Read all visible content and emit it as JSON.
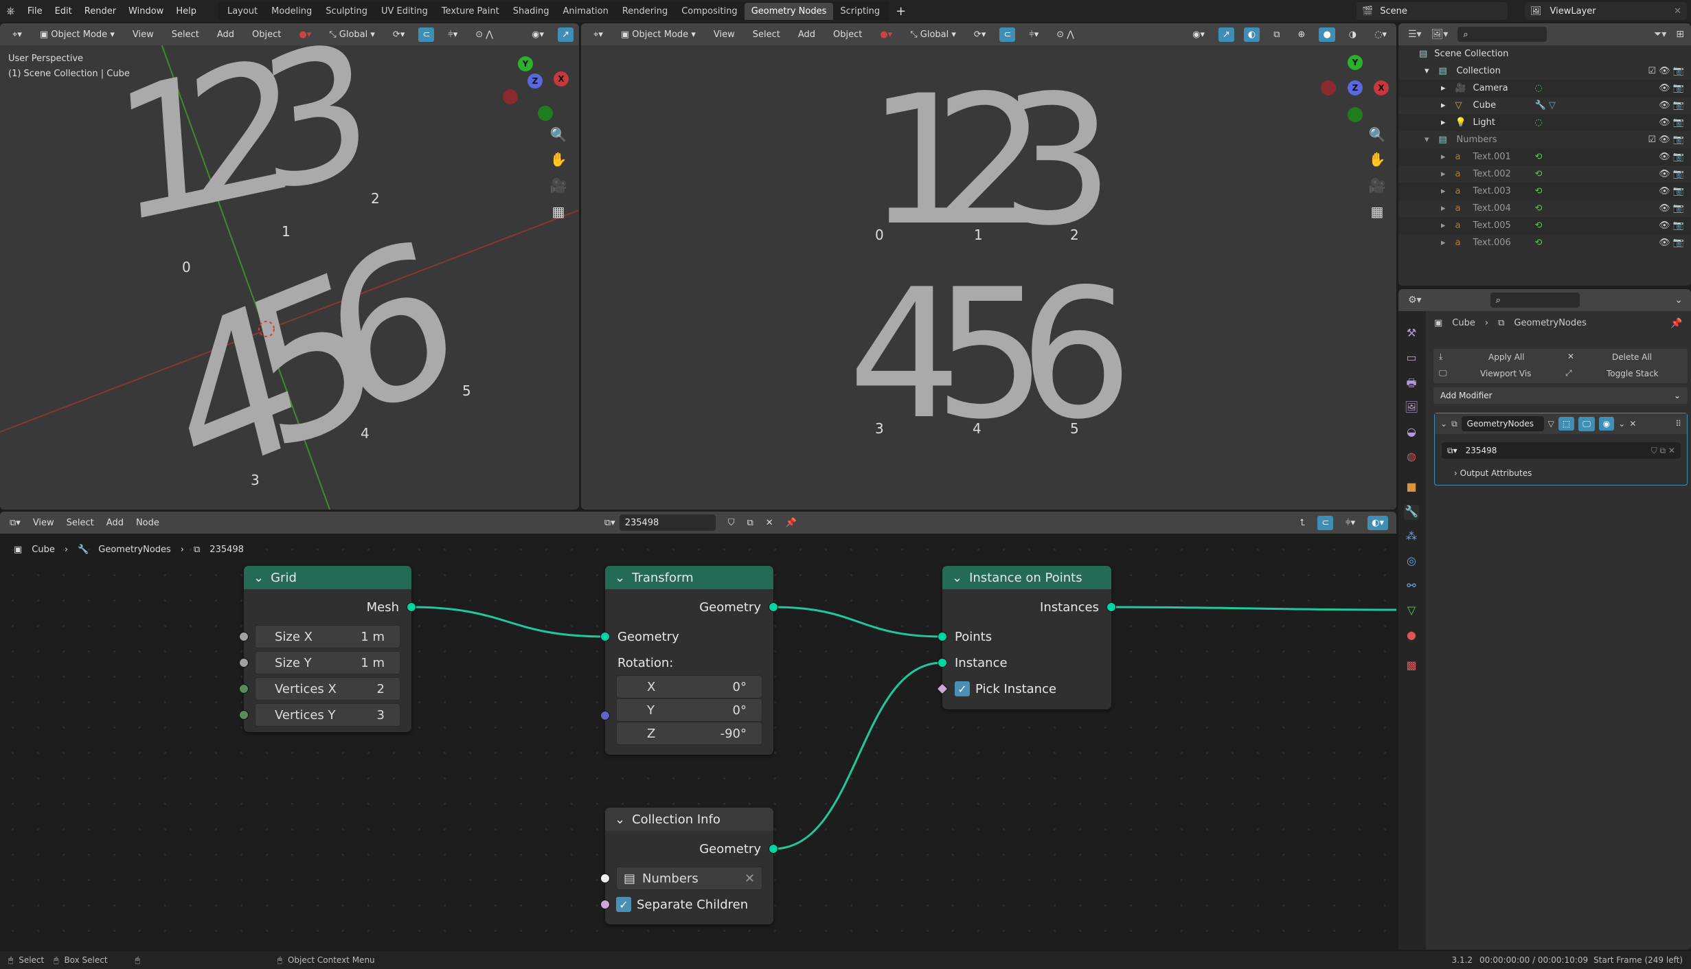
{
  "menu": [
    "File",
    "Edit",
    "Render",
    "Window",
    "Help"
  ],
  "workspaces": [
    "Layout",
    "Modeling",
    "Sculpting",
    "UV Editing",
    "Texture Paint",
    "Shading",
    "Animation",
    "Rendering",
    "Compositing",
    "Geometry Nodes",
    "Scripting"
  ],
  "active_workspace": "Geometry Nodes",
  "add_workspace": "+",
  "scene": "Scene",
  "view_layer": "ViewLayer",
  "viewport_header": {
    "mode": "Object Mode",
    "menus": [
      "View",
      "Select",
      "Add",
      "Object"
    ],
    "orientation": "Global"
  },
  "left_viewport": {
    "title": "User Perspective",
    "subtitle": "(1) Scene Collection | Cube",
    "row1": "123",
    "row2": "456",
    "labels": [
      "0",
      "1",
      "2",
      "3",
      "4",
      "5"
    ]
  },
  "right_viewport": {
    "row1": "123",
    "row2": "456",
    "labels": [
      "0",
      "1",
      "2",
      "3",
      "4",
      "5"
    ]
  },
  "gizmo": {
    "x": "X",
    "y": "Y",
    "z": "Z"
  },
  "outliner": {
    "root": "Scene Collection",
    "rows": [
      {
        "label": "Collection",
        "type": "collection",
        "level": 1
      },
      {
        "label": "Camera",
        "type": "camera",
        "level": 2
      },
      {
        "label": "Cube",
        "type": "mesh",
        "level": 2
      },
      {
        "label": "Light",
        "type": "light",
        "level": 2
      },
      {
        "label": "Numbers",
        "type": "collection",
        "level": 1
      },
      {
        "label": "Text.001",
        "type": "text",
        "level": 2
      },
      {
        "label": "Text.002",
        "type": "text",
        "level": 2
      },
      {
        "label": "Text.003",
        "type": "text",
        "level": 2
      },
      {
        "label": "Text.004",
        "type": "text",
        "level": 2
      },
      {
        "label": "Text.005",
        "type": "text",
        "level": 2
      },
      {
        "label": "Text.006",
        "type": "text",
        "level": 2
      }
    ]
  },
  "properties": {
    "breadcrumb": [
      "Cube",
      "GeometryNodes"
    ],
    "apply_all": "Apply All",
    "delete_all": "Delete All",
    "viewport_vis": "Viewport Vis",
    "toggle_stack": "Toggle Stack",
    "add_modifier": "Add Modifier",
    "modifier_name": "GeometryNodes",
    "node_group": "235498",
    "output_attributes": "Output Attributes"
  },
  "node_editor": {
    "menus": [
      "View",
      "Select",
      "Add",
      "Node"
    ],
    "node_group": "235498",
    "breadcrumb": [
      "Cube",
      "GeometryNodes",
      "235498"
    ]
  },
  "nodes": {
    "grid": {
      "title": "Grid",
      "output": "Mesh",
      "fields": [
        {
          "label": "Size X",
          "value": "1 m"
        },
        {
          "label": "Size Y",
          "value": "1 m"
        },
        {
          "label": "Vertices X",
          "value": "2"
        },
        {
          "label": "Vertices Y",
          "value": "3"
        }
      ]
    },
    "transform": {
      "title": "Transform",
      "output": "Geometry",
      "input": "Geometry",
      "rotation_label": "Rotation:",
      "rotation": [
        {
          "label": "X",
          "value": "0°"
        },
        {
          "label": "Y",
          "value": "0°"
        },
        {
          "label": "Z",
          "value": "-90°"
        }
      ]
    },
    "instance_on_points": {
      "title": "Instance on Points",
      "output": "Instances",
      "inputs": [
        "Points",
        "Instance"
      ],
      "pick_instance": "Pick Instance",
      "pick_checked": true
    },
    "collection_info": {
      "title": "Collection Info",
      "output": "Geometry",
      "collection": "Numbers",
      "separate_children": "Separate Children",
      "separate_checked": true
    }
  },
  "status": {
    "select": "Select",
    "box_select": "Box Select",
    "context_menu": "Object Context Menu",
    "version": "3.1.2",
    "time": "00:00:00:00 / 00:00:10:09",
    "frame": "Start Frame (249 left)"
  },
  "colors": {
    "accent": "#3f8eb5",
    "geometry_socket": "#00d6a3",
    "node_header": "#246b55",
    "x_axis": "#c8373c",
    "y_axis": "#2bb12b",
    "z_axis": "#5a68e0"
  }
}
